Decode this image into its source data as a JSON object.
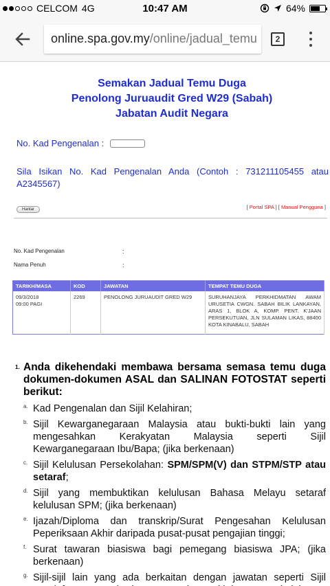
{
  "status_bar": {
    "carrier": "CELCOM",
    "network": "4G",
    "time": "10:47 AM",
    "battery": "64%",
    "battery_level": 0.64
  },
  "browser": {
    "url_host": "online.spa.gov.my",
    "url_path": "/online/jadual_temu",
    "tab_count": "2"
  },
  "page": {
    "title_line1": "Semakan Jadual Temu Duga",
    "title_line2": "Penolong Juruaudit Gred W29 (Sabah)",
    "title_line3": "Jabatan Audit Negara",
    "kad_label": "No. Kad Pengenalan :",
    "hint": "Sila Isikan No. Kad Pengenalan Anda (Contoh : 731211105455 atau A2345567)",
    "submit_label": "Hantar",
    "link_portal": "Portal SPA",
    "link_manual": "Manual Pengguna",
    "info": {
      "kad_label": "No. Kad Pengenalan",
      "nama_label": "Nama Penuh",
      "colon": ":"
    },
    "table": {
      "headers": [
        "TARIKH/MASA",
        "KOD",
        "JAWATAN",
        "TEMPAT TEMU DUGA"
      ],
      "row": {
        "date": "09/3/2018",
        "time": "09:00 PAGI",
        "kod": "2269",
        "jawatan": "PENOLONG JURUAUDIT GRED W29",
        "tempat": "SURUHANJAYA PERKHIDMATAN AWAM URUSETIA CWGN. SABAH BILIK LANKAYAN, ARAS 1, BLOK A, KOMP. PENT. K'JAAN PERSEKUTUAN, JLN SULAMAN LIKAS, 88400 KOTA KINABALU, SABAH"
      }
    },
    "instructions": {
      "number": "1.",
      "heading": "Anda dikehendaki membawa bersama semasa temu duga dokumen-dokumen ASAL dan SALINAN FOTOSTAT seperti berikut:",
      "items": [
        {
          "mark": "a.",
          "text": "Kad Pengenalan dan Sijil Kelahiran;"
        },
        {
          "mark": "b.",
          "text": "Sijil Kewarganegaraan Malaysia atau bukti-bukti lain yang mengesahkan Kerakyatan Malaysia seperti Sijil Kewarganegaraan Ibu/Bapa; (jika berkenaan)"
        },
        {
          "mark": "c.",
          "text_pre": "Sijil Kelulusan Persekolahan: ",
          "text_bold": "SPM/SPM(V) dan STPM/STP atau setaraf",
          "text_post": ";"
        },
        {
          "mark": "d.",
          "text": "Sijil yang membuktikan kelulusan Bahasa Melayu setaraf kelulusan SPM; (jika berkenaan)"
        },
        {
          "mark": "e.",
          "text": "Ijazah/Diploma dan transkrip/Surat Pengesahan Kelulusan Peperiksaan Akhir daripada pusat-pusat pengajian tinggi;"
        },
        {
          "mark": "f.",
          "text": "Surat tawaran biasiswa bagi pemegang biasiswa JPA; (jika berkenaan)"
        },
        {
          "mark": "g.",
          "text": "Sijil-sijil lain yang ada berkaitan dengan jawatan seperti Sijil Pendaftaran Penuh dengan Lembaga Ikhtisas atau kelulusan-kelulusan lain;"
        }
      ]
    }
  }
}
